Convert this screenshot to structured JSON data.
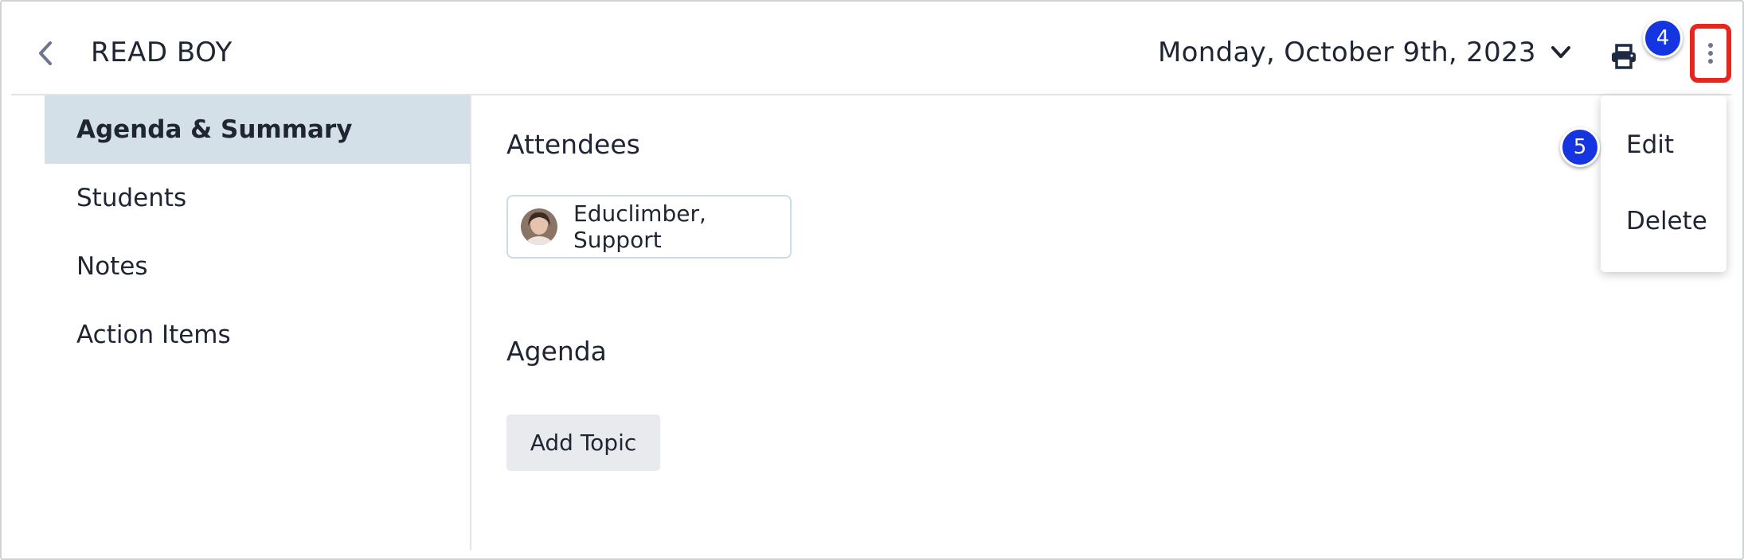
{
  "header": {
    "title": "READ BOY",
    "date": "Monday, October 9th, 2023",
    "back_icon": "chevron-left-icon",
    "print_icon": "printer-icon",
    "more_icon": "more-vertical-icon"
  },
  "steps": {
    "step4": "4",
    "step5": "5"
  },
  "sidebar": {
    "items": [
      {
        "label": "Agenda & Summary",
        "active": true
      },
      {
        "label": "Students",
        "active": false
      },
      {
        "label": "Notes",
        "active": false
      },
      {
        "label": "Action Items",
        "active": false
      }
    ]
  },
  "main": {
    "attendees_title": "Attendees",
    "attendees": [
      {
        "name": "Educlimber, Support"
      }
    ],
    "agenda_title": "Agenda",
    "add_topic_label": "Add Topic"
  },
  "menu": {
    "items": [
      {
        "label": "Edit"
      },
      {
        "label": "Delete"
      }
    ]
  },
  "colors": {
    "active_nav_bg": "#d3e0e8",
    "highlight_border": "#e8261d",
    "step_marker": "#1435e0",
    "button_bg": "#e8eaee"
  }
}
